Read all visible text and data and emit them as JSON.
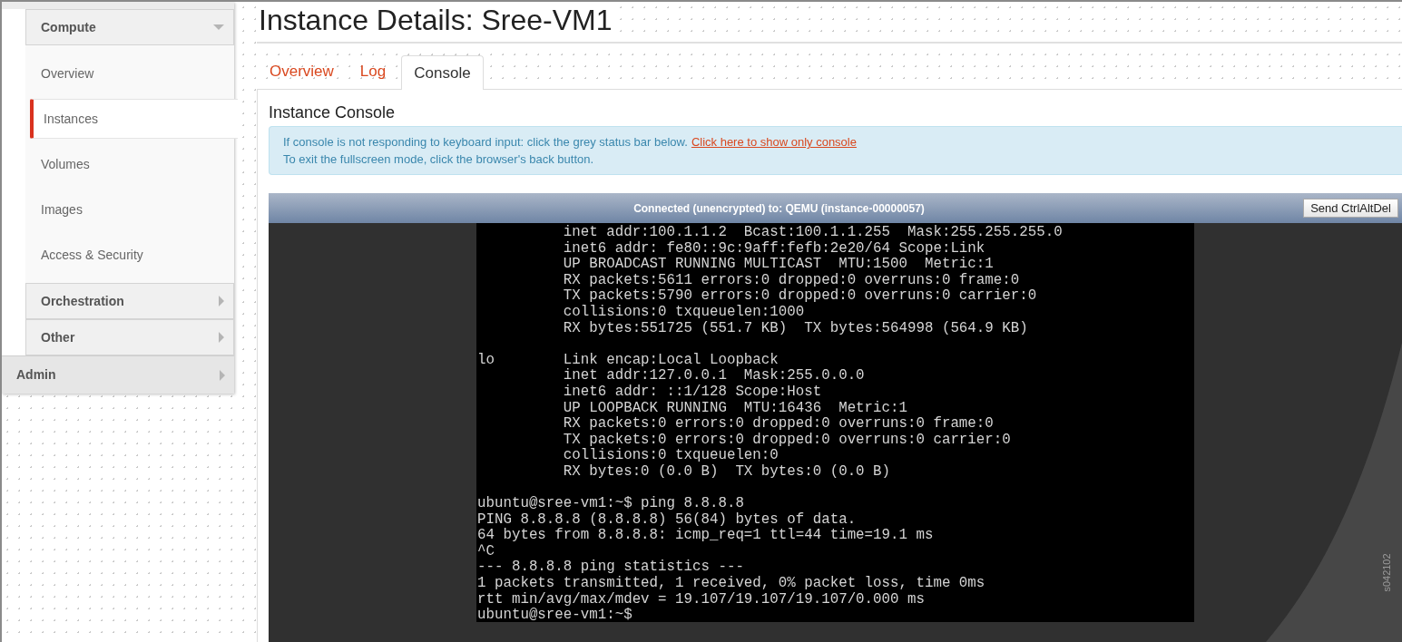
{
  "sidebar": {
    "panels": [
      {
        "label": "Compute",
        "expanded": true,
        "children": [
          {
            "label": "Overview",
            "selected": false
          },
          {
            "label": "Instances",
            "selected": true
          },
          {
            "label": "Volumes",
            "selected": false
          },
          {
            "label": "Images",
            "selected": false
          },
          {
            "label": "Access & Security",
            "selected": false
          }
        ]
      },
      {
        "label": "Orchestration",
        "expanded": false
      },
      {
        "label": "Other",
        "expanded": false
      }
    ],
    "dashboards": [
      {
        "label": "Admin",
        "expanded": false
      }
    ]
  },
  "page": {
    "title": "Instance Details: Sree-VM1"
  },
  "tabs": [
    {
      "label": "Overview",
      "selected": false
    },
    {
      "label": "Log",
      "selected": false
    },
    {
      "label": "Console",
      "selected": true
    }
  ],
  "console_panel": {
    "heading": "Instance Console",
    "info": {
      "line_1": "If console is not responding to keyboard input: click the grey status bar below.",
      "link": "Click here to show only console",
      "line_2": "To exit the fullscreen mode, click the browser's back button."
    },
    "status_bar": "Connected (unencrypted) to: QEMU (instance-00000057)",
    "button": "Send CtrlAltDel",
    "terminal": [
      [
        "          inet addr:100.1.1.2  Bcast:100.1.1.255  Mask:255.255.255.0",
        "          inet6 addr: fe80::9c:9aff:fefb:2e20/64 Scope:Link",
        "          UP BROADCAST RUNNING MULTICAST  MTU:1500  Metric:1",
        "          RX packets:5611 errors:0 dropped:0 overruns:0 frame:0",
        "          TX packets:5790 errors:0 dropped:0 overruns:0 carrier:0",
        "          collisions:0 txqueuelen:1000",
        "          RX bytes:551725 (551.7 KB)  TX bytes:564998 (564.9 KB)"
      ],
      [
        "lo        Link encap:Local Loopback",
        "          inet addr:127.0.0.1  Mask:255.0.0.0",
        "          inet6 addr: ::1/128 Scope:Host",
        "          UP LOOPBACK RUNNING  MTU:16436  Metric:1",
        "          RX packets:0 errors:0 dropped:0 overruns:0 frame:0",
        "          TX packets:0 errors:0 dropped:0 overruns:0 carrier:0",
        "          collisions:0 txqueuelen:0",
        "          RX bytes:0 (0.0 B)  TX bytes:0 (0.0 B)"
      ],
      [
        "ubuntu@sree-vm1:~$ ping 8.8.8.8",
        "PING 8.8.8.8 (8.8.8.8) 56(84) bytes of data.",
        "64 bytes from 8.8.8.8: icmp_req=1 ttl=44 time=19.1 ms",
        "^C",
        "--- 8.8.8.8 ping statistics ---",
        "1 packets transmitted, 1 received, 0% packet loss, time 0ms",
        "rtt min/avg/max/mdev = 19.107/19.107/19.107/0.000 ms",
        "ubuntu@sree-vm1:~$"
      ]
    ]
  },
  "figure_id": "s042102"
}
